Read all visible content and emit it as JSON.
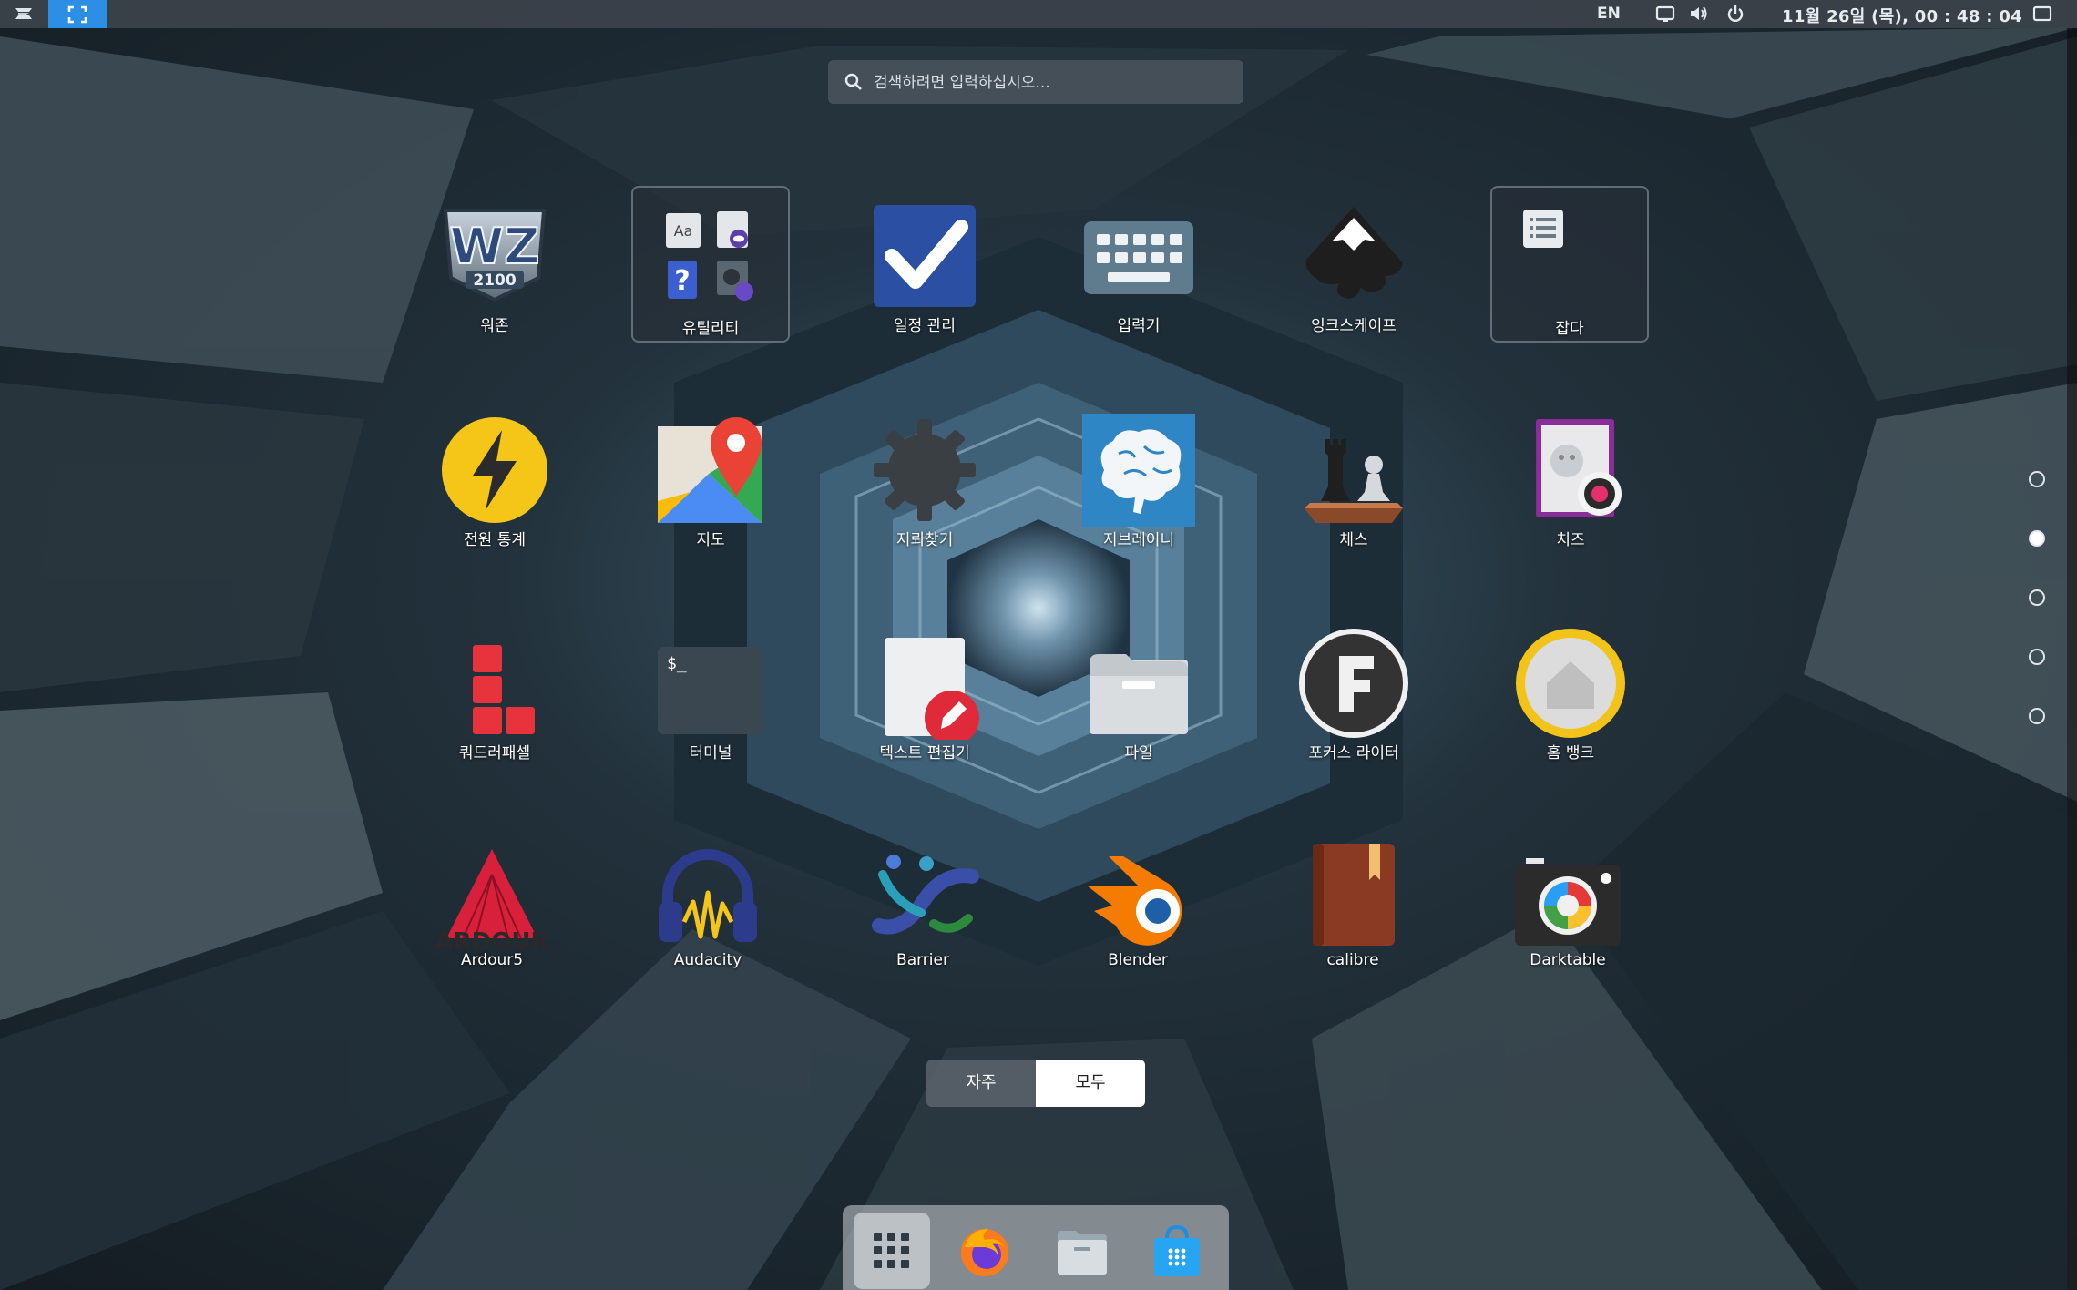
{
  "topbar": {
    "lang": "EN",
    "clock": "11월 26일 (목), 00 : 48 : 04"
  },
  "search": {
    "placeholder": "검색하려면 입력하십시오..."
  },
  "apps": [
    {
      "id": "warzone",
      "label": "워존",
      "icon": "warzone-2100-icon"
    },
    {
      "id": "utilities",
      "label": "유틸리티",
      "icon": "folder-icon"
    },
    {
      "id": "planner",
      "label": "일정 관리",
      "icon": "checkmark-icon"
    },
    {
      "id": "input",
      "label": "입력기",
      "icon": "keyboard-icon"
    },
    {
      "id": "inkscape",
      "label": "잉크스케이프",
      "icon": "inkscape-icon"
    },
    {
      "id": "misc",
      "label": "잡다",
      "icon": "folder-icon"
    },
    {
      "id": "power",
      "label": "전원 통계",
      "icon": "power-bolt-icon"
    },
    {
      "id": "maps",
      "label": "지도",
      "icon": "map-pin-icon"
    },
    {
      "id": "minesweeper",
      "label": "지뢰찾기",
      "icon": "mine-gear-icon"
    },
    {
      "id": "gbrainy",
      "label": "지브레이니",
      "icon": "brain-icon"
    },
    {
      "id": "chess",
      "label": "체스",
      "icon": "chess-icon"
    },
    {
      "id": "cheese",
      "label": "치즈",
      "icon": "webcam-icon"
    },
    {
      "id": "quadrapassel",
      "label": "쿼드러패셀",
      "icon": "blocks-icon"
    },
    {
      "id": "terminal",
      "label": "터미널",
      "icon": "terminal-icon"
    },
    {
      "id": "texteditor",
      "label": "텍스트 편집기",
      "icon": "text-editor-icon"
    },
    {
      "id": "files",
      "label": "파일",
      "icon": "file-cabinet-icon"
    },
    {
      "id": "focuswriter",
      "label": "포커스 라이터",
      "icon": "focuswriter-icon"
    },
    {
      "id": "homebank",
      "label": "홈 뱅크",
      "icon": "home-bank-icon"
    },
    {
      "id": "ardour",
      "label": "Ardour5",
      "icon": "ardour-icon"
    },
    {
      "id": "audacity",
      "label": "Audacity",
      "icon": "headphones-icon"
    },
    {
      "id": "barrier",
      "label": "Barrier",
      "icon": "barrier-icon"
    },
    {
      "id": "blender",
      "label": "Blender",
      "icon": "blender-icon"
    },
    {
      "id": "calibre",
      "label": "calibre",
      "icon": "book-icon"
    },
    {
      "id": "darktable",
      "label": "Darktable",
      "icon": "camera-icon"
    }
  ],
  "warzone_sub": "2100",
  "ardour_word": "ARDOUR",
  "toggle": {
    "frequent": "자주",
    "all": "모두"
  },
  "pages": {
    "count": 5,
    "current": 2
  },
  "dock": [
    {
      "id": "app-grid",
      "icon": "app-grid-icon"
    },
    {
      "id": "firefox",
      "icon": "firefox-icon"
    },
    {
      "id": "files",
      "icon": "folder-icon"
    },
    {
      "id": "software",
      "icon": "software-store-icon"
    }
  ]
}
